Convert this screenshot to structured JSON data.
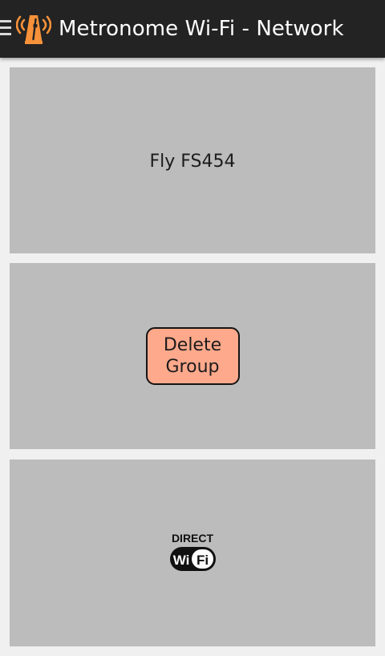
{
  "appbar": {
    "title": "Metronome Wi-Fi - Network",
    "menu_icon": "hamburger-menu-icon",
    "logo_icon": "metronome-logo-icon",
    "background_color": "#232323",
    "logo_color": "#f7923a"
  },
  "device": {
    "name": "Fly FS454"
  },
  "actions": {
    "delete_group_line1": "Delete",
    "delete_group_line2": "Group",
    "button_color": "#ffa98c"
  },
  "wifi_direct": {
    "icon": "wifi-direct-icon",
    "label_top": "DIRECT",
    "label_wi": "Wi",
    "label_fi": "Fi"
  },
  "panel_color": "#bcbcbc"
}
